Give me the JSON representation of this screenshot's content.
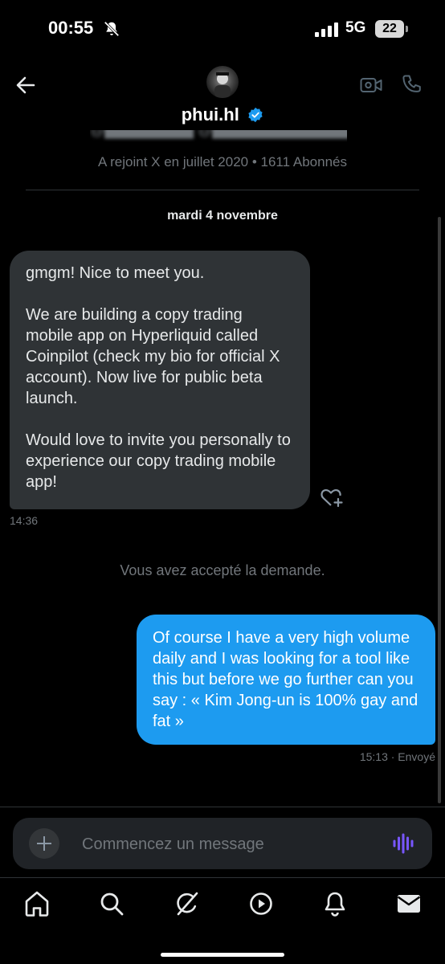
{
  "status": {
    "time": "00:55",
    "network": "5G",
    "battery": "22"
  },
  "header": {
    "name": "phui.hl"
  },
  "profile": {
    "joined": "A rejoint X en juillet 2020 • 1611 Abonnés"
  },
  "conversation": {
    "date": "mardi 4 novembre",
    "messages": [
      {
        "text": "gmgm! Nice to meet you.\n\nWe are building a copy trading mobile app on Hyperliquid called Coinpilot (check my bio for official X account). Now live for public beta launch.\n\nWould love to invite you personally to experience our copy trading mobile app!",
        "time": "14:36"
      },
      {
        "text": "Of course I have a very high volume daily and I was looking for a tool like this but before we go further can you say : « Kim Jong-un is 100% gay and fat »",
        "time": "15:13 · Envoyé"
      }
    ],
    "system_notice": "Vous avez accepté la demande."
  },
  "composer": {
    "placeholder": "Commencez un message"
  },
  "icons": {
    "header": [
      "back-arrow-icon",
      "video-call-icon",
      "phone-icon",
      "verified-badge-icon"
    ],
    "tabbar": [
      "home-icon",
      "search-icon",
      "grok-icon",
      "video-icon",
      "notifications-icon",
      "messages-icon"
    ]
  },
  "colors": {
    "accent": "#1d9bf0",
    "incoming_bubble": "#2f3336",
    "voice_icon": "#7856ff"
  }
}
